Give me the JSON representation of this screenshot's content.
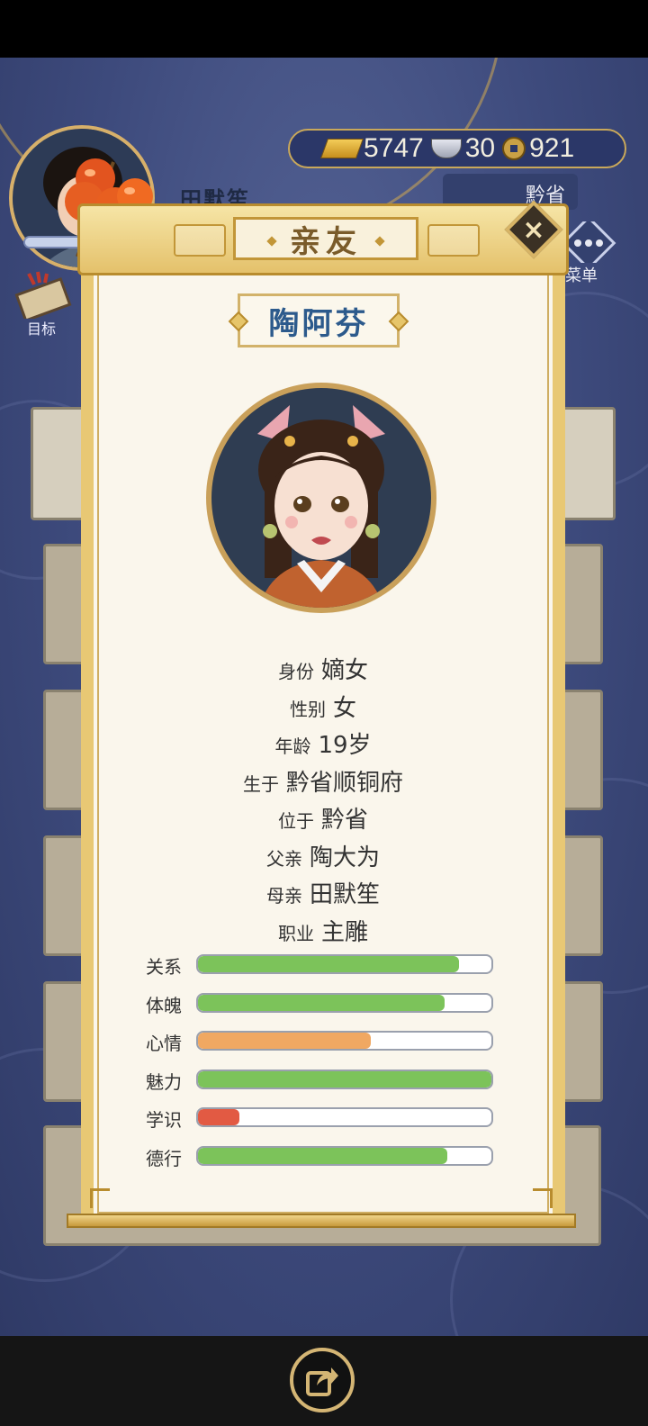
{
  "hud": {
    "player_name": "田默笙",
    "experience": 0.75,
    "goal_label": "目标",
    "region_label": "黔省",
    "menu_label": "菜单",
    "currency": {
      "gold": "5747",
      "silver": "30",
      "coins": "921"
    }
  },
  "dialog": {
    "title": "亲友",
    "character_name": "陶阿芬",
    "close_icon": "close-icon",
    "info": [
      {
        "key": "身份",
        "value": "嫡女"
      },
      {
        "key": "性别",
        "value": "女"
      },
      {
        "key": "年龄",
        "value": "19岁"
      },
      {
        "key": "生于",
        "value": "黔省顺铜府"
      },
      {
        "key": "位于",
        "value": "黔省"
      },
      {
        "key": "父亲",
        "value": "陶大为"
      },
      {
        "key": "母亲",
        "value": "田默笙"
      },
      {
        "key": "职业",
        "value": "主雕"
      }
    ],
    "stats": [
      {
        "label": "关系",
        "level": 0.89,
        "color": "#7cc35a"
      },
      {
        "label": "体魄",
        "level": 0.84,
        "color": "#7cc35a"
      },
      {
        "label": "心情",
        "level": 0.59,
        "color": "#f0a862"
      },
      {
        "label": "魅力",
        "level": 1.0,
        "color": "#7cc35a"
      },
      {
        "label": "学识",
        "level": 0.14,
        "color": "#e25a43"
      },
      {
        "label": "德行",
        "level": 0.85,
        "color": "#7cc35a"
      }
    ]
  },
  "share_icon": "share-icon"
}
